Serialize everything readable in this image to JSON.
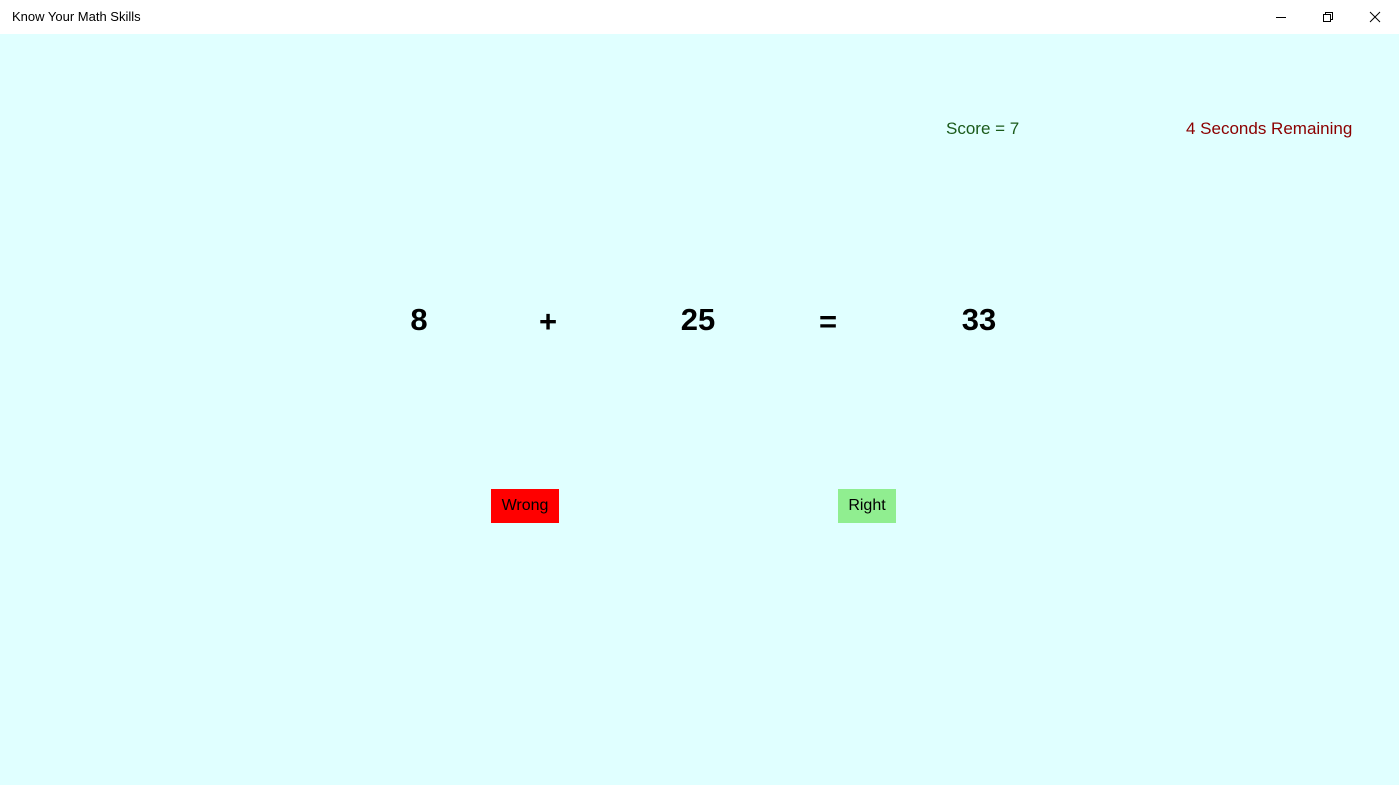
{
  "window": {
    "title": "Know Your Math Skills"
  },
  "status": {
    "score_text": "Score = 7",
    "timer_text": "4 Seconds Remaining"
  },
  "equation": {
    "operand_a": "8",
    "operator": "+",
    "operand_b": "25",
    "equals": "=",
    "result": "33"
  },
  "buttons": {
    "wrong_label": "Wrong",
    "right_label": "Right"
  },
  "colors": {
    "background": "#e0ffff",
    "wrong_button": "#ff0000",
    "right_button": "#90ee90",
    "score_text": "#1a5a1a",
    "timer_text": "#8b0000"
  }
}
